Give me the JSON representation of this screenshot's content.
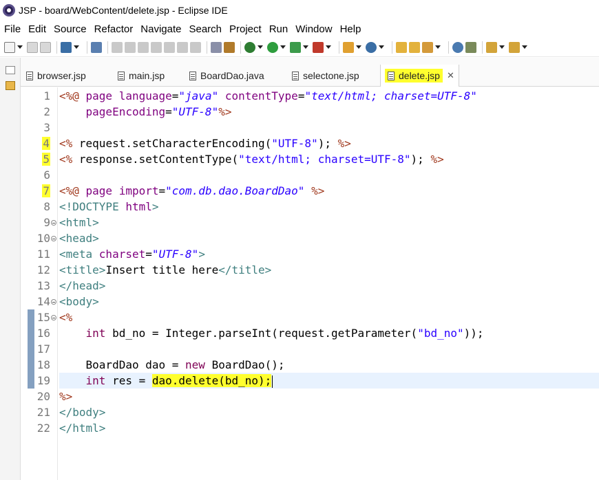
{
  "window": {
    "title": "JSP - board/WebContent/delete.jsp - Eclipse IDE"
  },
  "menu": [
    "File",
    "Edit",
    "Source",
    "Refactor",
    "Navigate",
    "Search",
    "Project",
    "Run",
    "Window",
    "Help"
  ],
  "tabs": [
    {
      "label": "browser.jsp"
    },
    {
      "label": "main.jsp"
    },
    {
      "label": "BoardDao.java"
    },
    {
      "label": "selectone.jsp"
    },
    {
      "label": "delete.jsp",
      "active": true,
      "close": "✕"
    }
  ],
  "editor": {
    "current_line": 19,
    "highlighted_line_numbers": [
      4,
      5,
      7
    ],
    "lines": [
      {
        "n": "1",
        "segments": [
          [
            "tag",
            "<%@ "
          ],
          [
            "attr",
            "page "
          ],
          [
            "attr",
            "language"
          ],
          [
            "txt",
            "="
          ],
          [
            "str",
            "\"java\""
          ],
          [
            "txt",
            " "
          ],
          [
            "attr",
            "contentType"
          ],
          [
            "txt",
            "="
          ],
          [
            "str",
            "\"text/html; charset=UTF-8\""
          ]
        ]
      },
      {
        "n": "2",
        "segments": [
          [
            "txt",
            "    "
          ],
          [
            "attr",
            "pageEncoding"
          ],
          [
            "txt",
            "="
          ],
          [
            "str",
            "\"UTF-8\""
          ],
          [
            "tag",
            "%>"
          ]
        ]
      },
      {
        "n": "3",
        "segments": []
      },
      {
        "n": "4",
        "segments": [
          [
            "tag",
            "<% "
          ],
          [
            "txt",
            "request.setCharacterEncoding("
          ],
          [
            "str2",
            "\"UTF-8\""
          ],
          [
            "txt",
            "); "
          ],
          [
            "tag",
            "%>"
          ]
        ]
      },
      {
        "n": "5",
        "segments": [
          [
            "tag",
            "<% "
          ],
          [
            "txt",
            "response.setContentType("
          ],
          [
            "str2",
            "\"text/html; charset=UTF-8\""
          ],
          [
            "txt",
            "); "
          ],
          [
            "tag",
            "%>"
          ]
        ]
      },
      {
        "n": "6",
        "segments": []
      },
      {
        "n": "7",
        "segments": [
          [
            "tag",
            "<%@ "
          ],
          [
            "attr",
            "page "
          ],
          [
            "attr",
            "import"
          ],
          [
            "txt",
            "="
          ],
          [
            "str",
            "\"com.db.dao.BoardDao\""
          ],
          [
            "txt",
            " "
          ],
          [
            "tag",
            "%>"
          ]
        ]
      },
      {
        "n": "8",
        "segments": [
          [
            "html",
            "<!DOCTYPE "
          ],
          [
            "attr",
            "html"
          ],
          [
            "html",
            ">"
          ]
        ]
      },
      {
        "n": "9",
        "segments": [
          [
            "html",
            "<html>"
          ]
        ]
      },
      {
        "n": "10",
        "segments": [
          [
            "html",
            "<head>"
          ]
        ]
      },
      {
        "n": "11",
        "segments": [
          [
            "html",
            "<meta "
          ],
          [
            "attr",
            "charset"
          ],
          [
            "txt",
            "="
          ],
          [
            "str",
            "\"UTF-8\""
          ],
          [
            "html",
            ">"
          ]
        ]
      },
      {
        "n": "12",
        "segments": [
          [
            "html",
            "<title>"
          ],
          [
            "txt",
            "Insert title here"
          ],
          [
            "html",
            "</title>"
          ]
        ]
      },
      {
        "n": "13",
        "segments": [
          [
            "html",
            "</head>"
          ]
        ]
      },
      {
        "n": "14",
        "segments": [
          [
            "html",
            "<body>"
          ]
        ]
      },
      {
        "n": "15",
        "segments": [
          [
            "tag",
            "<%"
          ]
        ]
      },
      {
        "n": "16",
        "segments": [
          [
            "txt",
            "    "
          ],
          [
            "kw",
            "int"
          ],
          [
            "txt",
            " bd_no = Integer.parseInt(request.getParameter("
          ],
          [
            "str2",
            "\"bd_no\""
          ],
          [
            "txt",
            "));"
          ]
        ]
      },
      {
        "n": "17",
        "segments": []
      },
      {
        "n": "18",
        "segments": [
          [
            "txt",
            "    BoardDao dao = "
          ],
          [
            "kw",
            "new"
          ],
          [
            "txt",
            " BoardDao();"
          ]
        ]
      },
      {
        "n": "19",
        "segments": [
          [
            "txt",
            "    "
          ],
          [
            "kw",
            "int"
          ],
          [
            "txt",
            " res = "
          ],
          [
            "mark",
            "dao.delete(bd_no);"
          ],
          [
            "caret",
            ""
          ]
        ]
      },
      {
        "n": "20",
        "segments": [
          [
            "tag",
            "%>"
          ]
        ]
      },
      {
        "n": "21",
        "segments": [
          [
            "html",
            "</body>"
          ]
        ]
      },
      {
        "n": "22",
        "segments": [
          [
            "html",
            "</html>"
          ]
        ]
      }
    ]
  },
  "colors": {
    "jsp_tag": "#a13a1f",
    "html_tag": "#3f7f7f",
    "attribute": "#7f007f",
    "string": "#2a00ff",
    "keyword": "#7f0055",
    "highlight": "#ffff2e",
    "current_line": "#e8f2fe"
  }
}
